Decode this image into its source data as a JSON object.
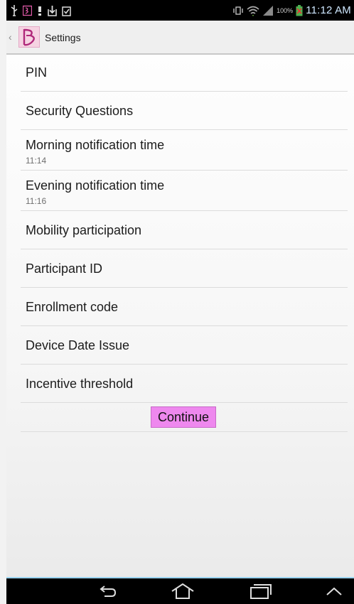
{
  "status_bar": {
    "clock": "11:12 AM",
    "battery_percent": "100%",
    "left_icons": [
      "usb-icon",
      "app-notification-icon",
      "alert-icon",
      "download-icon",
      "clipboard-check-icon"
    ],
    "right_icons": [
      "vibrate-icon",
      "wifi-icon",
      "signal-icon",
      "battery-icon"
    ]
  },
  "action_bar": {
    "title": "Settings",
    "logo_color": "#f6d3e2",
    "logo_accent": "#b0287a"
  },
  "settings": {
    "items": [
      {
        "title": "PIN"
      },
      {
        "title": "Security Questions"
      },
      {
        "title": "Morning notification time",
        "summary": "11:14"
      },
      {
        "title": "Evening notification time",
        "summary": "11:16"
      },
      {
        "title": "Mobility participation"
      },
      {
        "title": "Participant ID"
      },
      {
        "title": "Enrollment code"
      },
      {
        "title": "Device Date Issue"
      },
      {
        "title": "Incentive threshold"
      }
    ],
    "continue_label": "Continue",
    "continue_color": "#ee88ee"
  },
  "nav_bar": {
    "icons": [
      "back-icon",
      "home-icon",
      "recent-apps-icon",
      "menu-up-icon"
    ],
    "accent": "#9ad3f0"
  }
}
